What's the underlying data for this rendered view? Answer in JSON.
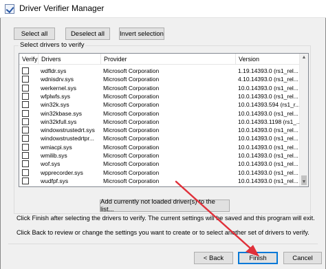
{
  "window": {
    "title": "Driver Verifier Manager"
  },
  "toolbar": {
    "select_all": "Select all",
    "deselect_all": "Deselect all",
    "invert_selection": "Invert selection"
  },
  "group": {
    "label": "Select drivers to verify"
  },
  "columns": {
    "verify": "Verify?",
    "drivers": "Drivers",
    "provider": "Provider",
    "version": "Version"
  },
  "rows": [
    {
      "driver": "wdfldr.sys",
      "provider": "Microsoft Corporation",
      "version": "1.19.14393.0 (rs1_rel..."
    },
    {
      "driver": "wdnisdrv.sys",
      "provider": "Microsoft Corporation",
      "version": "4.10.14393.0 (rs1_rel..."
    },
    {
      "driver": "werkernel.sys",
      "provider": "Microsoft Corporation",
      "version": "10.0.14393.0 (rs1_rel..."
    },
    {
      "driver": "wfplwfs.sys",
      "provider": "Microsoft Corporation",
      "version": "10.0.14393.0 (rs1_rel..."
    },
    {
      "driver": "win32k.sys",
      "provider": "Microsoft Corporation",
      "version": "10.0.14393.594 (rs1_r..."
    },
    {
      "driver": "win32kbase.sys",
      "provider": "Microsoft Corporation",
      "version": "10.0.14393.0 (rs1_rel..."
    },
    {
      "driver": "win32kfull.sys",
      "provider": "Microsoft Corporation",
      "version": "10.0.14393.1198 (rs1_..."
    },
    {
      "driver": "windowstrustedrt.sys",
      "provider": "Microsoft Corporation",
      "version": "10.0.14393.0 (rs1_rel..."
    },
    {
      "driver": "windowstrustedrtpr...",
      "provider": "Microsoft Corporation",
      "version": "10.0.14393.0 (rs1_rel..."
    },
    {
      "driver": "wmiacpi.sys",
      "provider": "Microsoft Corporation",
      "version": "10.0.14393.0 (rs1_rel..."
    },
    {
      "driver": "wmilib.sys",
      "provider": "Microsoft Corporation",
      "version": "10.0.14393.0 (rs1_rel..."
    },
    {
      "driver": "wof.sys",
      "provider": "Microsoft Corporation",
      "version": "10.0.14393.0 (rs1_rel..."
    },
    {
      "driver": "wpprecorder.sys",
      "provider": "Microsoft Corporation",
      "version": "10.0.14393.0 (rs1_rel..."
    },
    {
      "driver": "wudfpf.sys",
      "provider": "Microsoft Corporation",
      "version": "10.0.14393.0 (rs1_rel..."
    }
  ],
  "add_button": "Add currently not loaded driver(s) to the list...",
  "info": {
    "line1": "Click Finish after selecting the drivers to verify. The current settings will be saved and this program will exit.",
    "line2": "Click Back to review or change the settings you want to create or to select another set of drivers to verify."
  },
  "footer": {
    "back": "< Back",
    "finish": "Finish",
    "cancel": "Cancel"
  },
  "colors": {
    "default_button_border": "#0078d7",
    "annotation_arrow": "#e0303a"
  },
  "annotation": {
    "arrow_target": "finish-button"
  }
}
